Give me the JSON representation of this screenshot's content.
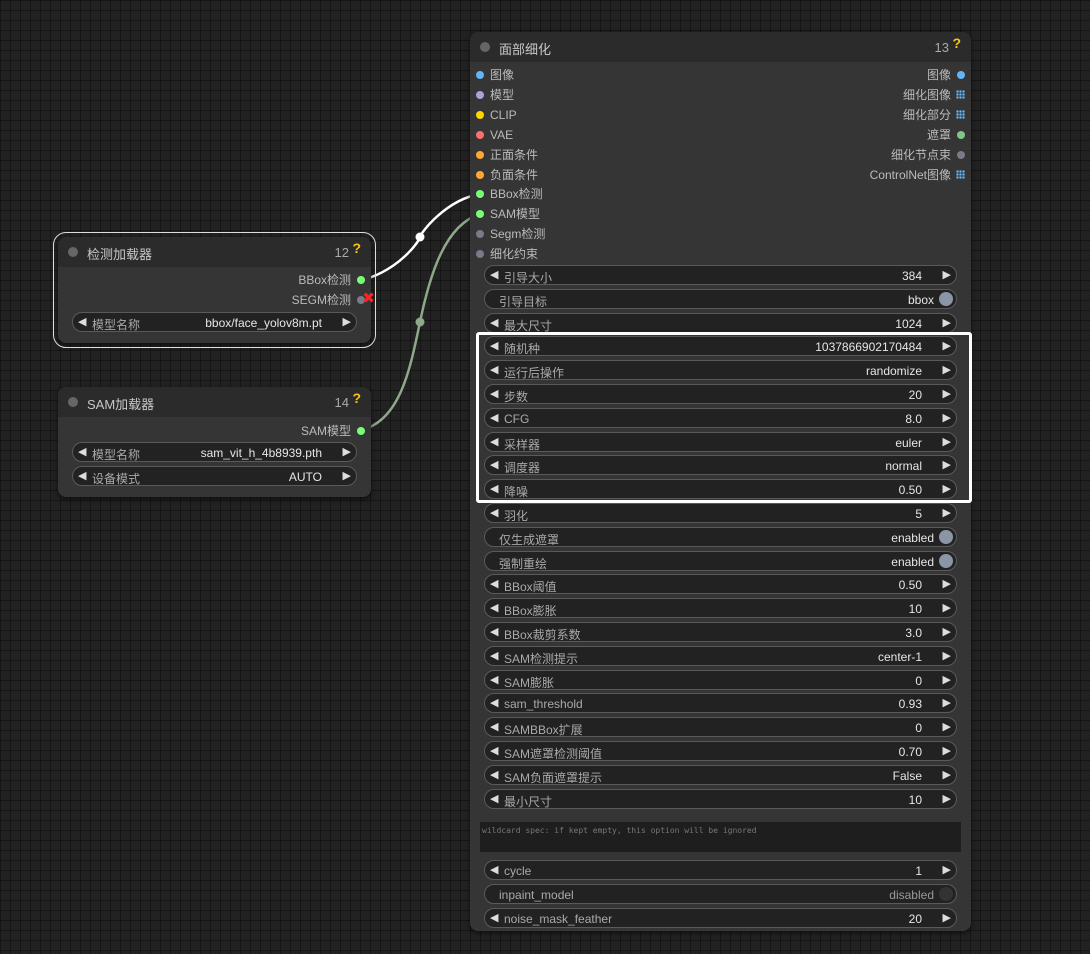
{
  "colors": {
    "image": "#64b5f6",
    "model": "#b39ddb",
    "clip": "#ffd500",
    "vae": "#ff6e6e",
    "conditioning": "#ffa931",
    "bbox": "#76ff76",
    "sam": "#76ff76",
    "segm": "#7a7a8a",
    "detailer": "#7a7a8a",
    "mask": "#81c784",
    "link": "#ffffff",
    "link_sam": "#8fa78a",
    "x": "#ff2222"
  },
  "detector_node": {
    "title": "检测加载器",
    "id": "12",
    "outputs": [
      {
        "label": "BBox检测"
      },
      {
        "label": "SEGM检测"
      }
    ],
    "widgets": [
      {
        "name": "模型名称",
        "value": "bbox/face_yolov8m.pt"
      }
    ]
  },
  "sam_node": {
    "title": "SAM加载器",
    "id": "14",
    "outputs": [
      {
        "label": "SAM模型"
      }
    ],
    "widgets": [
      {
        "name": "模型名称",
        "value": "sam_vit_h_4b8939.pth"
      },
      {
        "name": "设备模式",
        "value": "AUTO"
      }
    ]
  },
  "face_node": {
    "title": "面部细化",
    "id": "13",
    "help": "?",
    "inputs": [
      "图像",
      "模型",
      "CLIP",
      "VAE",
      "正面条件",
      "负面条件",
      "BBox检测",
      "SAM模型",
      "Segm检测",
      "细化约束"
    ],
    "outputs": [
      "图像",
      "细化图像",
      "细化部分",
      "遮罩",
      "细化节点束",
      "ControlNet图像"
    ],
    "widgets": [
      {
        "name": "引导大小",
        "value": "384"
      },
      {
        "name": "引导目标",
        "value": "bbox"
      },
      {
        "name": "最大尺寸",
        "value": "1024"
      },
      {
        "name": "随机种",
        "value": "1037866902170484"
      },
      {
        "name": "运行后操作",
        "value": "randomize"
      },
      {
        "name": "步数",
        "value": "20"
      },
      {
        "name": "CFG",
        "value": "8.0"
      },
      {
        "name": "采样器",
        "value": "euler"
      },
      {
        "name": "调度器",
        "value": "normal"
      },
      {
        "name": "降噪",
        "value": "0.50"
      },
      {
        "name": "羽化",
        "value": "5"
      },
      {
        "name": "仅生成遮罩",
        "value": "enabled"
      },
      {
        "name": "强制重绘",
        "value": "enabled"
      },
      {
        "name": "BBox阈值",
        "value": "0.50"
      },
      {
        "name": "BBox膨胀",
        "value": "10"
      },
      {
        "name": "BBox裁剪系数",
        "value": "3.0"
      },
      {
        "name": "SAM检测提示",
        "value": "center-1"
      },
      {
        "name": "SAM膨胀",
        "value": "0"
      },
      {
        "name": "sam_threshold",
        "value": "0.93"
      },
      {
        "name": "SAMBBox扩展",
        "value": "0"
      },
      {
        "name": "SAM遮罩检测阈值",
        "value": "0.70"
      },
      {
        "name": "SAM负面遮罩提示",
        "value": "False"
      },
      {
        "name": "最小尺寸",
        "value": "10"
      }
    ],
    "wildcard_text": "wildcard spec: if kept empty, this option will be ignored",
    "bottom_widgets": [
      {
        "name": "cycle",
        "value": "1"
      },
      {
        "name": "inpaint_model",
        "value": "disabled"
      },
      {
        "name": "noise_mask_feather",
        "value": "20"
      }
    ]
  }
}
